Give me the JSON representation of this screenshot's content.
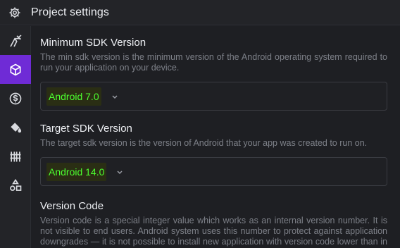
{
  "header": {
    "title": "Project settings"
  },
  "sections": {
    "min_sdk": {
      "title": "Minimum SDK Version",
      "description": "The min sdk version is the minimum version of the Android operating system required to run your application on your device.",
      "value": "Android 7.0"
    },
    "target_sdk": {
      "title": "Target SDK Version",
      "description": "The target sdk version is the version of Android that your app was created to run on.",
      "value": "Android 14.0"
    },
    "version_code": {
      "title": "Version Code",
      "description": "Version code is a special integer value which works as an internal version number. It is not visible to end users. Android system uses this number to protect against application downgrades — it is not possible to install new application with version code lower than in currently installed application."
    }
  },
  "sidebar": {
    "items": [
      {
        "icon": "build-tools-icon",
        "active": false
      },
      {
        "icon": "cube-icon",
        "active": true
      },
      {
        "icon": "coin-icon",
        "active": false
      },
      {
        "icon": "paint-bucket-icon",
        "active": false
      },
      {
        "icon": "fence-icon",
        "active": false
      },
      {
        "icon": "shapes-icon",
        "active": false
      }
    ]
  },
  "colors": {
    "accent": "#6f2bd6",
    "highlight_text": "#4cff2f",
    "background": "#1e1f23"
  }
}
